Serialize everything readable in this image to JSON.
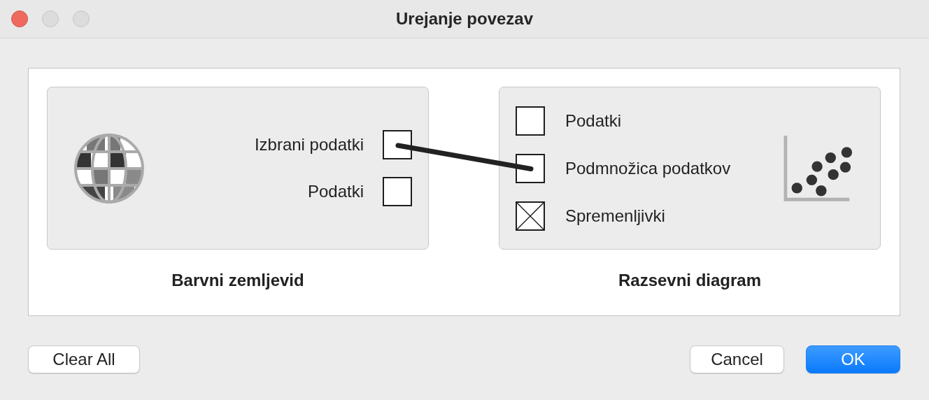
{
  "window": {
    "title": "Urejanje povezav"
  },
  "source": {
    "name": "Barvni zemljevid",
    "outputs": [
      {
        "label": "Izbrani podatki",
        "connected": true
      },
      {
        "label": "Podatki",
        "connected": false
      }
    ]
  },
  "sink": {
    "name": "Razsevni diagram",
    "inputs": [
      {
        "label": "Podatki",
        "connected": false,
        "disabled": false
      },
      {
        "label": "Podmnožica podatkov",
        "connected": true,
        "disabled": false
      },
      {
        "label": "Spremenljivki",
        "connected": false,
        "disabled": true
      }
    ]
  },
  "buttons": {
    "clear": "Clear All",
    "cancel": "Cancel",
    "ok": "OK"
  }
}
